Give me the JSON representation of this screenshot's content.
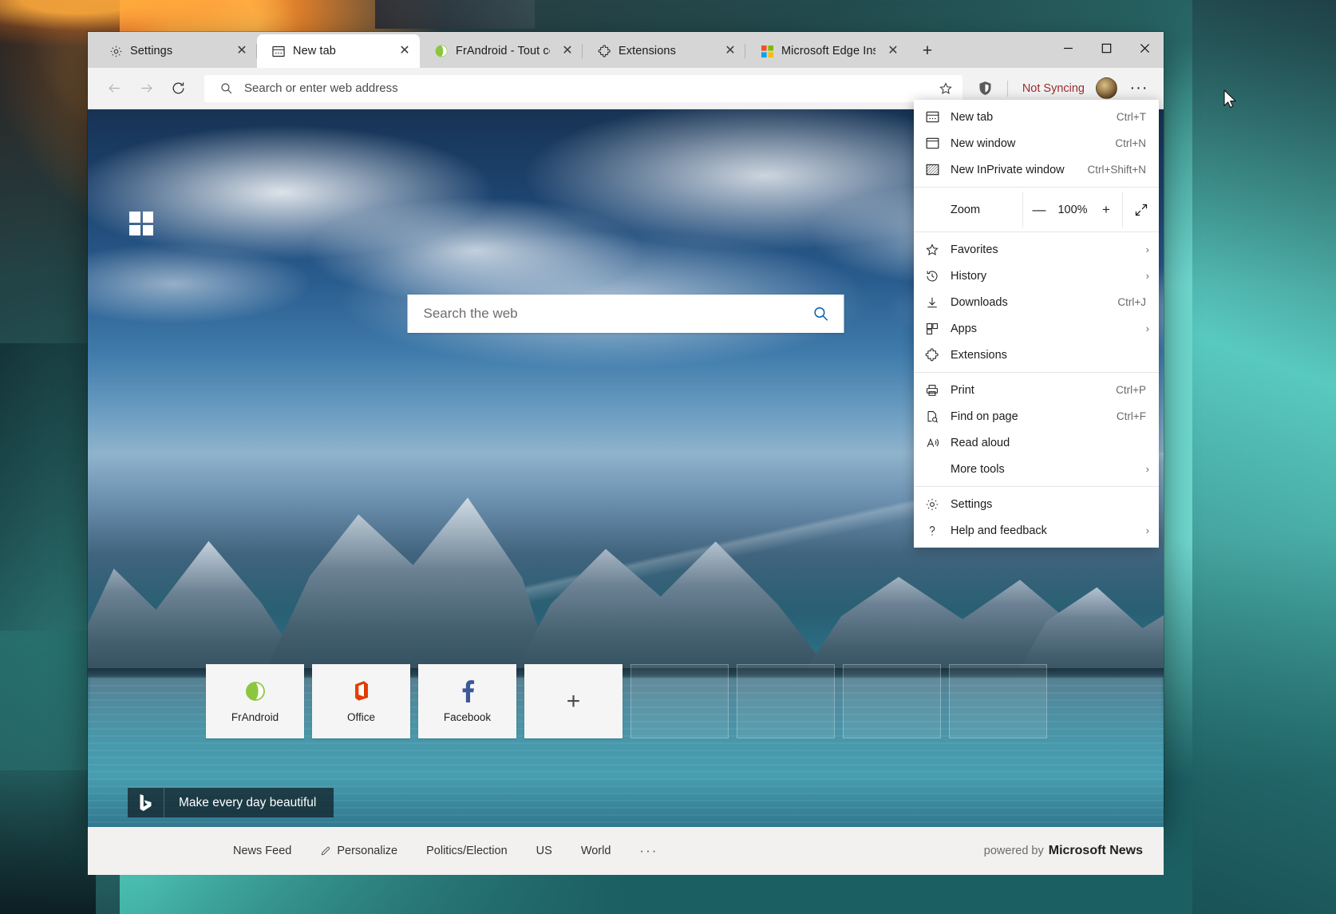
{
  "window": {
    "controls": {
      "minimize": "—",
      "maximize": "☐",
      "close": "✕"
    }
  },
  "tabs": [
    {
      "title": "Settings",
      "icon": "gear-icon",
      "close": "✕",
      "active": false
    },
    {
      "title": "New tab",
      "icon": "newtab-icon",
      "close": "✕",
      "active": true
    },
    {
      "title": "FrAndroid - Tout ce qu'il faut",
      "icon": "frandroid-icon",
      "close": "✕",
      "active": false
    },
    {
      "title": "Extensions",
      "icon": "puzzle-icon",
      "close": "✕",
      "active": false
    },
    {
      "title": "Microsoft Edge Insider Addo",
      "icon": "microsoft-icon",
      "close": "✕",
      "active": false
    }
  ],
  "new_tab_button": "+",
  "toolbar": {
    "back": "back-arrow-icon",
    "forward": "forward-arrow-icon",
    "refresh": "refresh-icon",
    "address_placeholder": "Search or enter web address",
    "address_value": "",
    "favorite": "star-icon",
    "shield": "shield-icon",
    "sync_status": "Not Syncing",
    "profile": "avatar",
    "settings_and_more": "···"
  },
  "menu": {
    "groups": [
      {
        "items": [
          {
            "label": "New tab",
            "shortcut": "Ctrl+T",
            "icon": "newtab-icon",
            "chevron": ""
          },
          {
            "label": "New window",
            "shortcut": "Ctrl+N",
            "icon": "window-icon",
            "chevron": ""
          },
          {
            "label": "New InPrivate window",
            "shortcut": "Ctrl+Shift+N",
            "icon": "inprivate-icon",
            "chevron": ""
          }
        ]
      },
      {
        "zoom": {
          "label": "Zoom",
          "minus": "—",
          "value": "100%",
          "plus": "+",
          "fullscreen": "fullscreen-icon"
        }
      },
      {
        "items": [
          {
            "label": "Favorites",
            "shortcut": "",
            "icon": "star-icon",
            "chevron": "›"
          },
          {
            "label": "History",
            "shortcut": "",
            "icon": "history-icon",
            "chevron": "›"
          },
          {
            "label": "Downloads",
            "shortcut": "Ctrl+J",
            "icon": "download-icon",
            "chevron": ""
          },
          {
            "label": "Apps",
            "shortcut": "",
            "icon": "apps-icon",
            "chevron": "›"
          },
          {
            "label": "Extensions",
            "shortcut": "",
            "icon": "puzzle-icon",
            "chevron": ""
          }
        ]
      },
      {
        "items": [
          {
            "label": "Print",
            "shortcut": "Ctrl+P",
            "icon": "printer-icon",
            "chevron": ""
          },
          {
            "label": "Find on page",
            "shortcut": "Ctrl+F",
            "icon": "find-icon",
            "chevron": ""
          },
          {
            "label": "Read aloud",
            "shortcut": "",
            "icon": "read-aloud-icon",
            "chevron": ""
          },
          {
            "label": "More tools",
            "shortcut": "",
            "icon": "",
            "chevron": "›"
          }
        ]
      },
      {
        "items": [
          {
            "label": "Settings",
            "shortcut": "",
            "icon": "gear-icon",
            "chevron": ""
          },
          {
            "label": "Help and feedback",
            "shortcut": "",
            "icon": "question-icon",
            "chevron": "›"
          }
        ]
      }
    ]
  },
  "newtab": {
    "logo": "windows-logo",
    "search": {
      "placeholder": "Search the web",
      "value": "",
      "icon": "search-icon"
    },
    "tiles": [
      {
        "label": "FrAndroid",
        "icon": "frandroid-icon",
        "type": "site"
      },
      {
        "label": "Office",
        "icon": "office-icon",
        "type": "site"
      },
      {
        "label": "Facebook",
        "icon": "facebook-icon",
        "type": "site"
      },
      {
        "label": "",
        "icon": "plus-icon",
        "type": "add"
      },
      {
        "label": "",
        "icon": "",
        "type": "empty"
      },
      {
        "label": "",
        "icon": "",
        "type": "empty"
      },
      {
        "label": "",
        "icon": "",
        "type": "empty"
      },
      {
        "label": "",
        "icon": "",
        "type": "empty"
      }
    ],
    "bing_banner": {
      "icon": "bing-icon",
      "text": "Make every day beautiful"
    }
  },
  "newsbar": {
    "links": [
      {
        "label": "News Feed",
        "icon": ""
      },
      {
        "label": "Personalize",
        "icon": "pencil-icon"
      },
      {
        "label": "Politics/Election",
        "icon": ""
      },
      {
        "label": "US",
        "icon": ""
      },
      {
        "label": "World",
        "icon": ""
      }
    ],
    "more": "···",
    "powered_prefix": "powered by",
    "powered_brand": "Microsoft News"
  },
  "colors": {
    "accent_red": "#9b2c2c",
    "tabstrip": "#d6d6d6",
    "toolbar": "#f2f2f2",
    "menu_bg": "#ffffff",
    "newsbar": "#f2f1ef"
  }
}
